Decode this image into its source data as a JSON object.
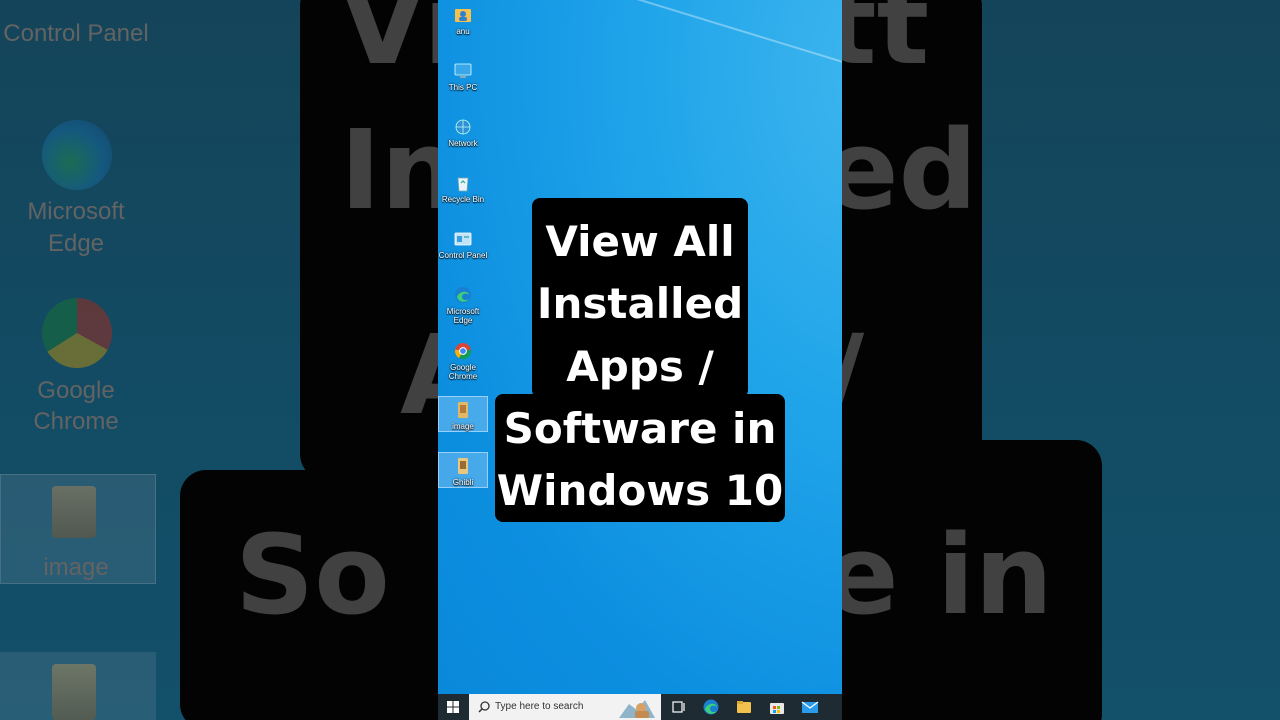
{
  "caption": {
    "lines": [
      "View All",
      "Installed",
      "Apps /",
      "Software in",
      "Windows 10"
    ]
  },
  "desktop_icons": [
    {
      "label": "anu",
      "icon": "user-folder-icon"
    },
    {
      "label": "This PC",
      "icon": "this-pc-icon"
    },
    {
      "label": "Network",
      "icon": "network-icon"
    },
    {
      "label": "Recycle Bin",
      "icon": "recycle-bin-icon"
    },
    {
      "label": "Control Panel",
      "icon": "control-panel-icon"
    },
    {
      "label": "Microsoft Edge",
      "icon": "edge-icon"
    },
    {
      "label": "Google Chrome",
      "icon": "chrome-icon"
    },
    {
      "label": "image",
      "icon": "image-folder-icon"
    },
    {
      "label": "Ghibli",
      "icon": "ghibli-folder-icon"
    }
  ],
  "taskbar": {
    "search_placeholder": "Type here to search",
    "pinned": [
      "task-view-icon",
      "edge-icon",
      "file-explorer-icon",
      "store-icon",
      "mail-icon"
    ]
  },
  "background": {
    "left_labels": [
      "Control Panel",
      "Microsoft Edge",
      "Google Chrome",
      "image"
    ],
    "left_label_lines": {
      "edge": [
        "Microsoft",
        "Edge"
      ],
      "chrome": [
        "Google",
        "Chrome"
      ]
    },
    "right_fragments": [
      "tt",
      "ed",
      "/",
      "e in"
    ],
    "left_fragments": [
      "Vi",
      "In",
      "A",
      "So"
    ]
  },
  "colors": {
    "desktop_blue": "#1ea3ea",
    "caption_bg": "#000000",
    "caption_text": "#ffffff",
    "taskbar_bg": "#1f2b33"
  }
}
